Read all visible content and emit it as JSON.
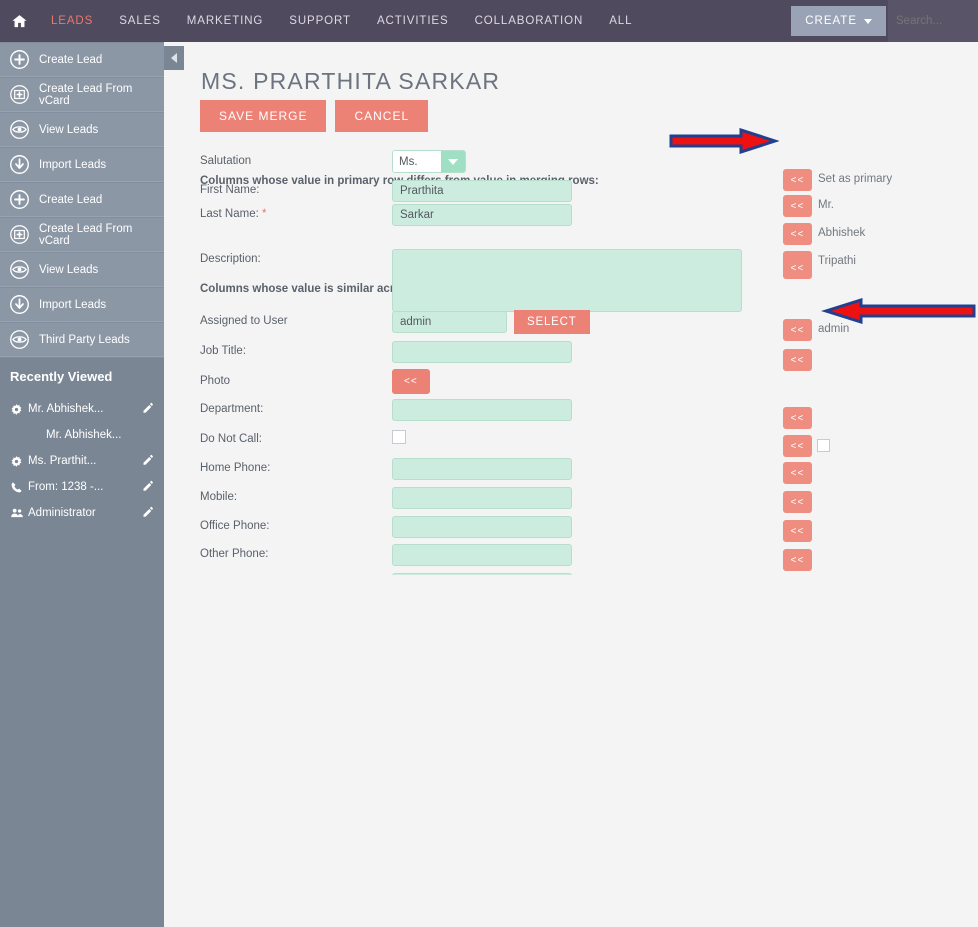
{
  "topnav": {
    "home_icon": "home-icon",
    "items": [
      {
        "label": "LEADS",
        "active": true
      },
      {
        "label": "SALES",
        "active": false
      },
      {
        "label": "MARKETING",
        "active": false
      },
      {
        "label": "SUPPORT",
        "active": false
      },
      {
        "label": "ACTIVITIES",
        "active": false
      },
      {
        "label": "COLLABORATION",
        "active": false
      },
      {
        "label": "ALL",
        "active": false
      }
    ],
    "create_label": "CREATE",
    "search_placeholder": "Search...",
    "bg_color": "#4f4a5e",
    "active_color": "#e8796e"
  },
  "sidebar": {
    "items": [
      {
        "label": "Create Lead",
        "icon": "plus-circle-icon"
      },
      {
        "label": "Create Lead From vCard",
        "icon": "plus-square-icon"
      },
      {
        "label": "View Leads",
        "icon": "eye-icon"
      },
      {
        "label": "Import Leads",
        "icon": "download-arrow-icon"
      },
      {
        "label": "Create Lead",
        "icon": "plus-circle-icon"
      },
      {
        "label": "Create Lead From vCard",
        "icon": "plus-square-icon"
      },
      {
        "label": "View Leads",
        "icon": "eye-icon"
      },
      {
        "label": "Import Leads",
        "icon": "download-arrow-icon"
      },
      {
        "label": "Third Party Leads",
        "icon": "eye-icon"
      }
    ],
    "recent_header": "Recently Viewed",
    "recent_items": [
      {
        "label": "Mr. Abhishek...",
        "icon": "gear-icon",
        "indent": false,
        "edit": true
      },
      {
        "label": "Mr. Abhishek...",
        "icon": "",
        "indent": true,
        "edit": false
      },
      {
        "label": "Ms. Prarthit...",
        "icon": "gear-icon",
        "indent": false,
        "edit": true
      },
      {
        "label": "From: 1238 -...",
        "icon": "phone-icon",
        "indent": false,
        "edit": true
      },
      {
        "label": "Administrator",
        "icon": "users-icon",
        "indent": false,
        "edit": true
      }
    ],
    "bg_color": "#8c97a6"
  },
  "main": {
    "page_title": "MS. PRARTHITA SARKAR",
    "save_merge_label": "SAVE MERGE",
    "cancel_label": "CANCEL",
    "note_differs": "Columns whose value in primary row differs from value in merging rows:",
    "note_similar": "Columns whose value is similar across all rows:",
    "select_label": "SELECT",
    "merge_button_label": "<<",
    "accent_coral": "#ec8175",
    "field_green": "#cdece0",
    "fields": {
      "salutation_label": "Salutation",
      "salutation_value": "Ms.",
      "first_name_label": "First Name:",
      "first_name_value": "Prarthita",
      "last_name_label": "Last Name:",
      "last_name_required": "*",
      "last_name_value": "Sarkar",
      "description_label": "Description:",
      "description_value": "",
      "assigned_label": "Assigned to User",
      "assigned_value": "admin",
      "job_title_label": "Job Title:",
      "job_title_value": "",
      "photo_label": "Photo",
      "department_label": "Department:",
      "department_value": "",
      "do_not_call_label": "Do Not Call:",
      "home_phone_label": "Home Phone:",
      "home_phone_value": "",
      "mobile_label": "Mobile:",
      "mobile_value": "",
      "office_phone_label": "Office Phone:",
      "office_phone_value": "",
      "other_phone_label": "Other Phone:",
      "other_phone_value": ""
    },
    "merge_labels": {
      "set_as_primary": "Set as primary",
      "salutation": "Mr.",
      "first_name": "Abhishek",
      "last_name": "Tripathi",
      "assigned": "admin"
    }
  },
  "annotations": {
    "arrow_color": "#ee1111",
    "arrow_border": "#22408f",
    "arrow_top_target": "set-as-primary-merge-button",
    "arrow_mid_target": "description-merge-button"
  }
}
